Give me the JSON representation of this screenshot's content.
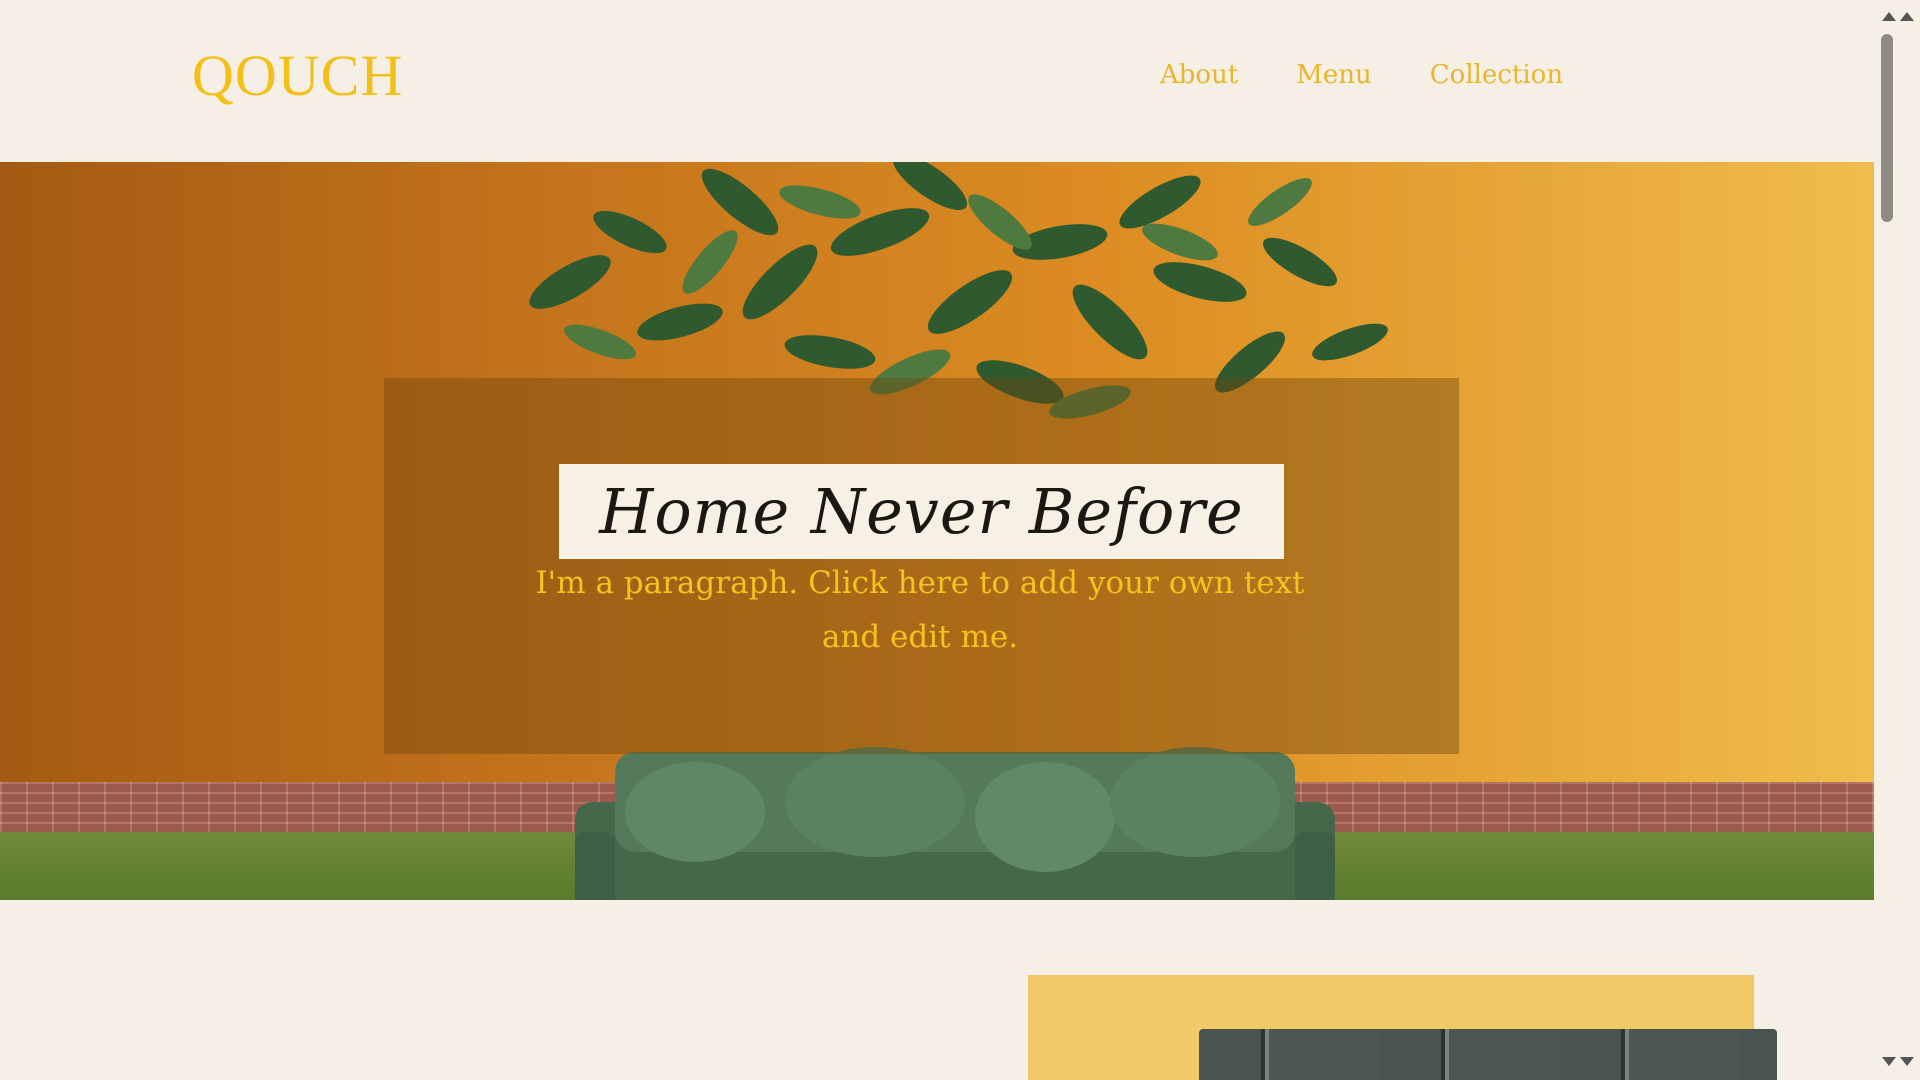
{
  "header": {
    "logo": "QOUCH",
    "nav": [
      {
        "label": "About"
      },
      {
        "label": "Menu"
      },
      {
        "label": "Collection"
      }
    ]
  },
  "hero": {
    "title": "Home Never Before",
    "paragraph": "I'm a paragraph. Click here to add your own text and edit me."
  },
  "colors": {
    "accent": "#f3c01a",
    "background": "#f6efe6",
    "panel": "#f2c967"
  },
  "icons": {
    "scroll_up": "arrow-up-icon",
    "scroll_down": "arrow-down-icon"
  }
}
